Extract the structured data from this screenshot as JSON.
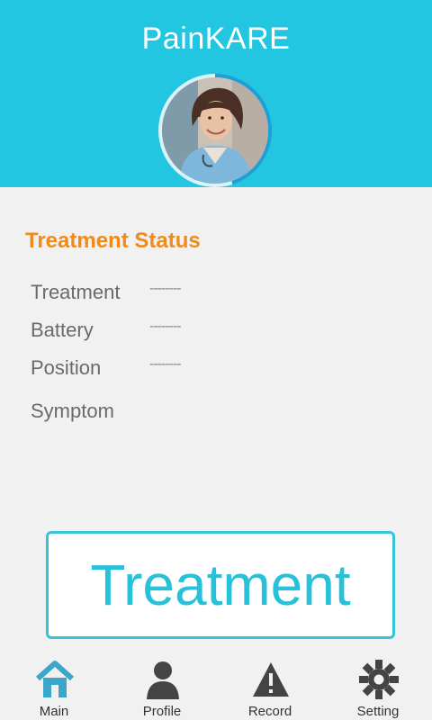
{
  "app": {
    "title": "PainKARE"
  },
  "colors": {
    "primary": "#23c6e0",
    "accent_orange": "#f08a1a",
    "active_nav": "#3aa7c9",
    "inactive_nav": "#444444"
  },
  "profile": {
    "avatar": "doctor-avatar"
  },
  "status": {
    "title": "Treatment Status",
    "rows": [
      {
        "label": "Treatment",
        "value": "--------"
      },
      {
        "label": "Battery",
        "value": "--------"
      },
      {
        "label": "Position",
        "value": "--------"
      },
      {
        "label": "Symptom",
        "value": ""
      }
    ]
  },
  "treatment_button": {
    "label": "Treatment"
  },
  "nav": {
    "items": [
      {
        "label": "Main",
        "icon": "home-icon",
        "active": true
      },
      {
        "label": "Profile",
        "icon": "person-icon",
        "active": false
      },
      {
        "label": "Record",
        "icon": "warning-icon",
        "active": false
      },
      {
        "label": "Setting",
        "icon": "gear-icon",
        "active": false
      }
    ]
  }
}
